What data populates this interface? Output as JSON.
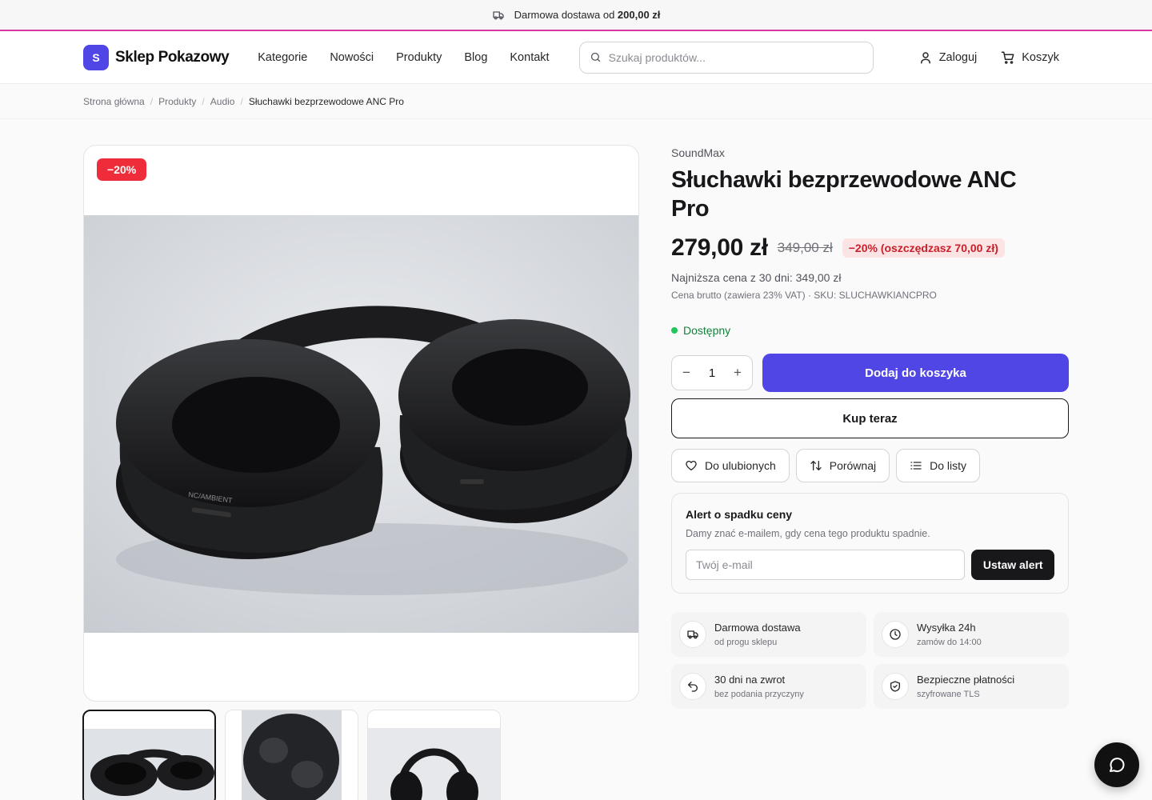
{
  "promo": {
    "text": "Darmowa dostawa od ",
    "amount": "200,00 zł",
    "icon": "truck-icon"
  },
  "header": {
    "logo_letter": "S",
    "logo_text": "Sklep Pokazowy",
    "nav": [
      "Kategorie",
      "Nowości",
      "Produkty",
      "Blog",
      "Kontakt"
    ],
    "search_placeholder": "Szukaj produktów...",
    "login_label": "Zaloguj",
    "cart_label": "Koszyk"
  },
  "breadcrumb": [
    "Strona główna",
    "Produkty",
    "Audio",
    "Słuchawki bezprzewodowe ANC Pro"
  ],
  "gallery": {
    "badge": "−20%",
    "main_image": "headphones-photo",
    "thumbnail_count": 3
  },
  "product": {
    "brand": "SoundMax",
    "title": "Słuchawki bezprzewodowe ANC Pro",
    "price": "279,00 zł",
    "old_price": "349,00 zł",
    "save_badge": "−20% (oszczędzasz 70,00 zł)",
    "lowest_price": "Najniższa cena z 30 dni: 349,00 zł",
    "gross_info": "Cena brutto (zawiera 23% VAT) · SKU: SLUCHAWKIANCPRO",
    "stock": "Dostępny",
    "quantity": "1",
    "add_to_cart": "Dodaj do koszyka",
    "buy_now": "Kup teraz",
    "wishlist": "Do ulubionych",
    "compare": "Porównaj",
    "list": "Do listy"
  },
  "price_alert": {
    "title": "Alert o spadku ceny",
    "description": "Damy znać e-mailem, gdy cena tego produktu spadnie.",
    "placeholder": "Twój e-mail",
    "button": "Ustaw alert"
  },
  "benefits": [
    {
      "title": "Darmowa dostawa",
      "sub": "od progu sklepu",
      "icon": "truck-icon"
    },
    {
      "title": "Wysyłka 24h",
      "sub": "zamów do 14:00",
      "icon": "clock-icon"
    },
    {
      "title": "30 dni na zwrot",
      "sub": "bez podania przyczyny",
      "icon": "return-icon"
    },
    {
      "title": "Bezpieczne płatności",
      "sub": "szyfrowane TLS",
      "icon": "shield-icon"
    }
  ],
  "colors": {
    "accent": "#4f46e5",
    "sale": "#ef2d3a",
    "stock": "#22c55e",
    "promo_border": "#d63aa0"
  }
}
